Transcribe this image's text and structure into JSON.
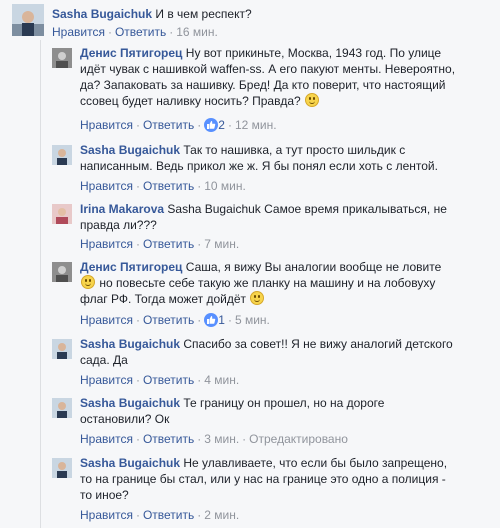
{
  "actions": {
    "like": "Нравится",
    "reply": "Ответить",
    "dot": "·",
    "edited": "Отредактировано"
  },
  "comments": [
    {
      "name": "Sasha Bugaichuk",
      "text": "И в чем респект?",
      "time": "16 мин.",
      "likes": ""
    },
    {
      "name": "Денис Пятигорец",
      "line1": "Ну вот прикиньте, Москва, 1943 год. По улице",
      "line2": "идёт чувак с нашивкой waffen-ss. А его пакуют менты. Невероятно,",
      "line3": "да? Запаковать за нашивку. Бред! Да кто поверит, что настоящий",
      "line4": "ссовец будет наливку носить? Правда?",
      "time": "12 мин.",
      "likes": "2"
    },
    {
      "name": "Sasha Bugaichuk",
      "line1": "Так то нашивка, а тут просто шильдик с",
      "line2": "написанным. Ведь прикол же ж. Я бы понял если хоть с лентой.",
      "time": "10 мин.",
      "likes": ""
    },
    {
      "name": "Irina Makarova",
      "line1": "Sasha Bugaichuk Самое время прикалываться, не",
      "line2": "правда ли???",
      "time": "7 мин.",
      "likes": ""
    },
    {
      "name": "Денис Пятигорец",
      "line1": "Саша, я вижу Вы аналогии вообще не ловите",
      "line2": "но повесьте себе такую же планку на машину и на лобовуху",
      "line3": "флаг РФ. Тогда может дойдёт",
      "time": "5 мин.",
      "likes": "1"
    },
    {
      "name": "Sasha Bugaichuk",
      "line1": "Спасибо за совет!! Я не вижу аналогий детского",
      "line2": "сада. Да",
      "time": "4 мин.",
      "likes": ""
    },
    {
      "name": "Sasha Bugaichuk",
      "line1": "Те границу он прошел, но на дороге",
      "line2": "остановили? Ок",
      "time": "3 мин.",
      "likes": ""
    },
    {
      "name": "Sasha Bugaichuk",
      "line1": "Не улавливаете, что если бы было запрещено,",
      "line2": "то на границе бы стал, или у нас на границе это одно а полиция -",
      "line3": "то иное?",
      "time": "2 мин.",
      "likes": ""
    }
  ]
}
